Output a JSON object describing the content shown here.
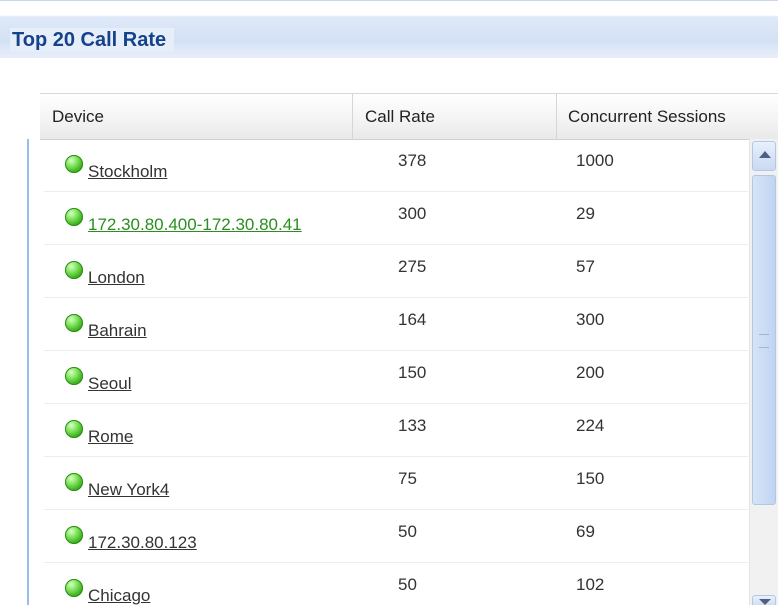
{
  "panel": {
    "title": "Top 20 Call Rate"
  },
  "grid": {
    "columns": [
      "Device",
      "Call Rate",
      "Concurrent Sessions"
    ],
    "rows": [
      {
        "device": "Stockholm",
        "call_rate": "378",
        "sessions": "1000",
        "status": "online"
      },
      {
        "device": "172.30.80.400-172.30.80.41",
        "call_rate": "300",
        "sessions": "29",
        "status": "online",
        "link_visited": true
      },
      {
        "device": "London",
        "call_rate": "275",
        "sessions": "57",
        "status": "online"
      },
      {
        "device": "Bahrain",
        "call_rate": "164",
        "sessions": "300",
        "status": "online"
      },
      {
        "device": "Seoul",
        "call_rate": "150",
        "sessions": "200",
        "status": "online"
      },
      {
        "device": "Rome",
        "call_rate": "133",
        "sessions": "224",
        "status": "online"
      },
      {
        "device": "New York4",
        "call_rate": "75",
        "sessions": "150",
        "status": "online"
      },
      {
        "device": "172.30.80.123",
        "call_rate": "50",
        "sessions": "69",
        "status": "online"
      },
      {
        "device": "Chicago",
        "call_rate": "50",
        "sessions": "102",
        "status": "online"
      }
    ]
  },
  "colors": {
    "title": "#15428b",
    "status_online": "#2fa514",
    "link_green": "#2a8f1e"
  },
  "icons": {
    "status": "status-online-icon",
    "scroll_up": "chevron-up-icon",
    "scroll_down": "chevron-down-icon"
  }
}
